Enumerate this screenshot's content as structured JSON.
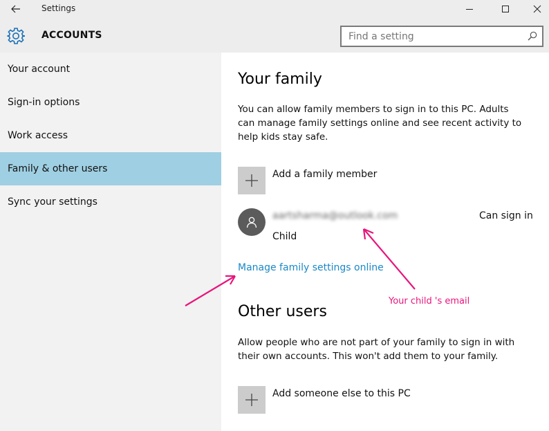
{
  "window": {
    "title": "Settings"
  },
  "header": {
    "title": "ACCOUNTS",
    "search_placeholder": "Find a setting"
  },
  "sidebar": {
    "items": [
      {
        "label": "Your account"
      },
      {
        "label": "Sign-in options"
      },
      {
        "label": "Work access"
      },
      {
        "label": "Family & other users",
        "selected": true
      },
      {
        "label": "Sync your settings"
      }
    ]
  },
  "family": {
    "title": "Your family",
    "description": "You can allow family members to sign in to this PC. Adults can manage family settings online and see recent activity to help kids stay safe.",
    "add_label": "Add a family member",
    "member": {
      "email": "aartsharma@outlook.com",
      "status": "Can sign in",
      "role": "Child"
    },
    "manage_link": "Manage family settings online"
  },
  "other_users": {
    "title": "Other users",
    "description": "Allow people who are not part of your family to sign in with their own accounts. This won't add them to your family.",
    "add_label": "Add someone else to this PC"
  },
  "annotation": {
    "label": "Your child 's email",
    "color": "#e8157c"
  },
  "colors": {
    "accent_selected": "#9fcfe2",
    "link": "#1a88c6",
    "gear": "#1a6fb8"
  }
}
